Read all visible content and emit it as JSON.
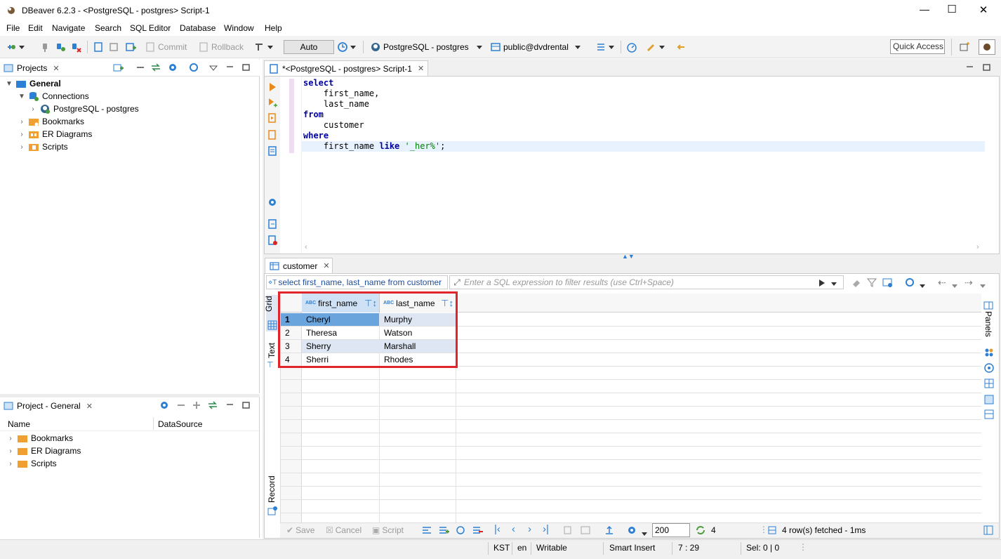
{
  "window": {
    "title": "DBeaver 6.2.3 - <PostgreSQL - postgres> Script-1",
    "controls": [
      "—",
      "☐",
      "✕"
    ]
  },
  "menu": [
    "File",
    "Edit",
    "Navigate",
    "Search",
    "SQL Editor",
    "Database",
    "Window",
    "Help"
  ],
  "toolbar": {
    "commit": "Commit",
    "rollback": "Rollback",
    "mode": "Auto",
    "connection": "PostgreSQL - postgres",
    "schema": "public@dvdrental",
    "quick_access": "Quick Access"
  },
  "projects_panel": {
    "tab": "Projects",
    "tree": {
      "root": "General",
      "connections": "Connections",
      "connection_item": "PostgreSQL - postgres",
      "bookmarks": "Bookmarks",
      "er_diagrams": "ER Diagrams",
      "scripts": "Scripts"
    }
  },
  "project_general_panel": {
    "tab": "Project - General",
    "columns": [
      "Name",
      "DataSource"
    ],
    "items": [
      "Bookmarks",
      "ER Diagrams",
      "Scripts"
    ]
  },
  "editor": {
    "tab": "*<PostgreSQL - postgres> Script-1",
    "lines": [
      [
        {
          "t": "select",
          "k": true
        }
      ],
      [
        {
          "t": "    first_name,",
          "k": false
        }
      ],
      [
        {
          "t": "    last_name",
          "k": false
        }
      ],
      [
        {
          "t": "from",
          "k": true
        }
      ],
      [
        {
          "t": "    customer",
          "k": false
        }
      ],
      [
        {
          "t": "where",
          "k": true
        }
      ],
      [
        {
          "t": "    first_name ",
          "k": false
        },
        {
          "t": "like",
          "k": true
        },
        {
          "t": " ",
          "k": false
        },
        {
          "t": "'_her%'",
          "s": true
        },
        {
          "t": ";",
          "k": false
        }
      ]
    ]
  },
  "results": {
    "tab": "customer",
    "query_label": "select first_name, last_name from customer",
    "filter_placeholder": "Enter a SQL expression to filter results (use Ctrl+Space)",
    "side_tabs": {
      "grid": "Grid",
      "text": "Text",
      "record": "Record"
    },
    "panels_label": "Panels",
    "columns": [
      {
        "type": "ABC",
        "name": "first_name"
      },
      {
        "type": "ABC",
        "name": "last_name"
      }
    ],
    "rows": [
      {
        "num": "1",
        "first_name": "Cheryl",
        "last_name": "Murphy"
      },
      {
        "num": "2",
        "first_name": "Theresa",
        "last_name": "Watson"
      },
      {
        "num": "3",
        "first_name": "Sherry",
        "last_name": "Marshall"
      },
      {
        "num": "4",
        "first_name": "Sherri",
        "last_name": "Rhodes"
      }
    ],
    "bottom": {
      "save": "Save",
      "cancel": "Cancel",
      "script": "Script",
      "fetch_size": "200",
      "row_count": "4",
      "status": "4 row(s) fetched - 1ms"
    }
  },
  "statusbar": {
    "tz": "KST",
    "lang": "en",
    "mode": "Writable",
    "insert": "Smart Insert",
    "pos": "7 : 29",
    "sel": "Sel: 0 | 0"
  },
  "colors": {
    "accent": "#2d7fd4",
    "highlight_box": "#e0252b",
    "keyword": "#0000a0",
    "string": "#008000",
    "selected_cell": "#6aa4dd"
  }
}
